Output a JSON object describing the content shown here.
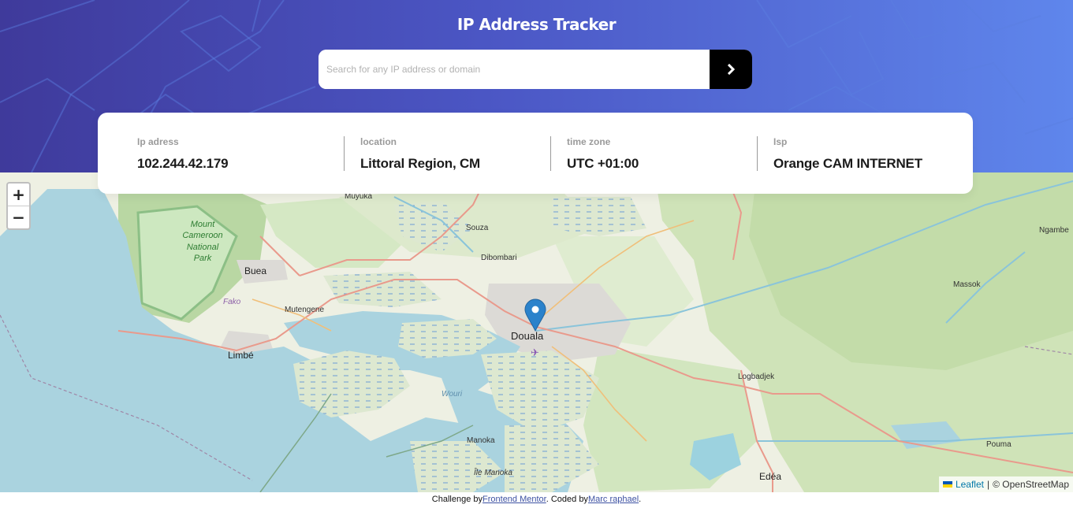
{
  "header": {
    "title": "IP Address Tracker",
    "gradient_start": "#3f3a9b",
    "gradient_end": "#5f86ec"
  },
  "search": {
    "placeholder": "Search for any IP address or domain",
    "value": "",
    "submit_icon": "chevron-right-icon"
  },
  "info": {
    "ip_label": "Ip adress",
    "ip_value": "102.244.42.179",
    "location_label": "location",
    "location_value": "Littoral Region, CM",
    "timezone_label": "time zone",
    "timezone_value": "UTC +01:00",
    "isp_label": "Isp",
    "isp_value": "Orange CAM INTERNET"
  },
  "map": {
    "zoom_in": "+",
    "zoom_out": "−",
    "marker_icon": "location-pin-icon",
    "labels": {
      "muyuka": "Muyuka",
      "souza": "Souza",
      "mount_cameroon_1": "Mount",
      "mount_cameroon_2": "Cameroon",
      "mount_cameroon_3": "National",
      "mount_cameroon_4": "Park",
      "buea": "Buea",
      "dibombari": "Dibombari",
      "fako": "Fako",
      "mutengene": "Mutengene",
      "douala": "Douala",
      "limbe": "Limbé",
      "wouri": "Wouri",
      "manoka": "Manoka",
      "ile_manoka": "Île Manoka",
      "massok": "Massok",
      "ngambe": "Ngambe",
      "logbadjek": "Logbadjek",
      "pouma": "Pouma",
      "edea": "Edéa"
    },
    "attribution_leaflet": "Leaflet",
    "attribution_sep": "|",
    "attribution_osm": "© OpenStreetMap",
    "colors": {
      "water": "#aad3df",
      "land": "#f2efe9",
      "forest": "#add19e",
      "park": "#c8facc",
      "road": "#e892a2",
      "marker": "#3a87c6"
    }
  },
  "footer": {
    "prefix": "Challenge by",
    "mentor_link": "Frontend Mentor",
    "middle": ". Coded by",
    "author_link": "Marc raphael",
    "suffix": "."
  }
}
